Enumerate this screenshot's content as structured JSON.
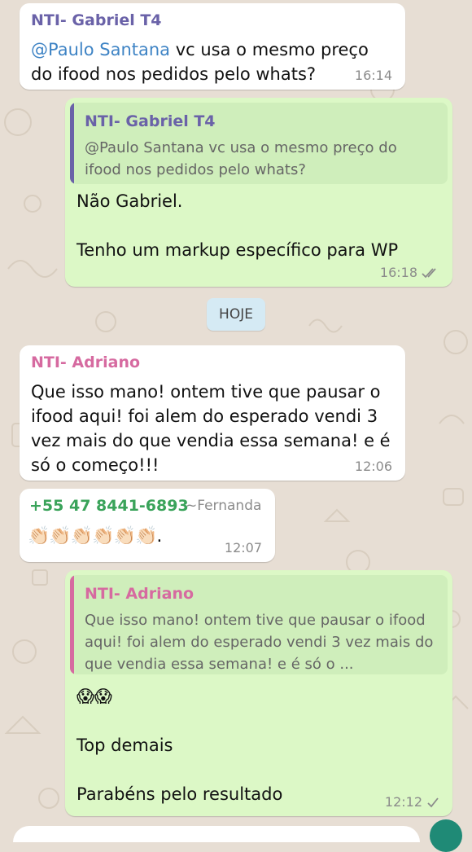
{
  "chat": {
    "date_divider": "HOJE",
    "messages": [
      {
        "sender": "NTI- Gabriel T4",
        "mention": "@Paulo Santana",
        "text": " vc usa o mesmo preço do ifood nos pedidos pelo whats?",
        "time": "16:14"
      },
      {
        "quote_sender": "NTI- Gabriel T4",
        "quote_text": "@Paulo Santana vc usa o mesmo preço do ifood nos pedidos pelo whats?",
        "text": "Não Gabriel.\n\nTenho um markup específico para WP",
        "time": "16:18",
        "status": "read"
      },
      {
        "sender": "NTI- Adriano",
        "text": "Que isso mano! ontem tive que pausar o ifood aqui! foi alem do esperado vendi 3 vez mais do que vendia essa semana! e é só o começo!!!",
        "time": "12:06"
      },
      {
        "sender": "+55 47 8441-6893",
        "push_name": "~Fernanda",
        "text": "👏🏻👏🏻👏🏻👏🏻👏🏻👏🏻.",
        "time": "12:07"
      },
      {
        "quote_sender": "NTI- Adriano",
        "quote_text": "Que isso mano! ontem tive que pausar o ifood aqui! foi alem do esperado vendi 3 vez mais do que vendia essa semana! e é só o ...",
        "text": "😱😱\n\nTop demais\n\nParabéns pelo resultado",
        "time": "12:12",
        "status": "sent"
      }
    ]
  },
  "colors": {
    "gabriel": "#6a62a8",
    "adriano": "#d66aa0",
    "fernanda": "#3aa35a",
    "mention": "#3f84c5",
    "read_tick": "#8b8b8b"
  }
}
